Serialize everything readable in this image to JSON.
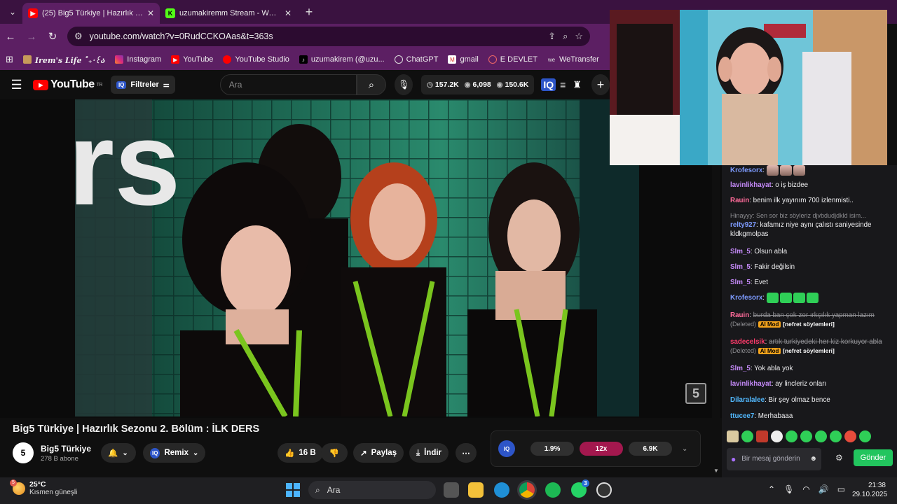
{
  "tabs": [
    {
      "title": "(25) Big5 Türkiye | Hazırlık Sezo",
      "favicon": "youtube-icon",
      "active": true
    },
    {
      "title": "uzumakiremm Stream - Watch Li",
      "favicon": "kick-icon",
      "active": false
    }
  ],
  "address": {
    "url": "youtube.com/watch?v=0RudCCKOAas&t=363s"
  },
  "bookmarks": [
    {
      "label": "Irem's Life ˚₊‧꒰ა",
      "icon": "bookmark-icon"
    },
    {
      "label": "Instagram",
      "icon": "instagram-icon"
    },
    {
      "label": "YouTube",
      "icon": "youtube-icon"
    },
    {
      "label": "YouTube Studio",
      "icon": "youtube-studio-icon"
    },
    {
      "label": "uzumakirem (@uzu...",
      "icon": "tiktok-icon"
    },
    {
      "label": "ChatGPT",
      "icon": "chatgpt-icon"
    },
    {
      "label": "gmail",
      "icon": "gmail-icon"
    },
    {
      "label": "E DEVLET",
      "icon": "edevlet-icon"
    },
    {
      "label": "WeTransfer",
      "icon": "wetransfer-icon"
    }
  ],
  "youtube": {
    "logo": "YouTube",
    "logo_sup": "TR",
    "filters_label": "Filtreler",
    "search_placeholder": "Ara",
    "stats": {
      "likes": "157.2K",
      "views": "6,098",
      "watch": "150.6K"
    }
  },
  "video": {
    "title": "Big5 Türkiye | Hazırlık Sezonu 2. Bölüm : İLK DERS",
    "channel_name": "Big5 Türkiye",
    "channel_subs": "278 B abone",
    "watermark": "5",
    "remix_label": "Remix",
    "like_count": "16 B",
    "share_label": "Paylaş",
    "download_label": "İndir"
  },
  "iq_panel": {
    "logo": "IQ",
    "metric1": "1.9%",
    "metric2": "12x",
    "metric3": "6.9K"
  },
  "chat": {
    "messages": [
      {
        "user": "Krofesorx",
        "text": "",
        "kind": "emotes-face"
      },
      {
        "user": "lavinlikhayat",
        "text": "o iş bizdee"
      },
      {
        "user": "Rauin",
        "text": "benim ilk yayınım 700 izlenmisti.."
      },
      {
        "reply": "Hinayyy: Sen sor biz söyleriz djvbdudjdkld isim...",
        "user": "relty927",
        "text": "kafamız niye aynı çalıstı saniyesinde kldkgmolpas"
      },
      {
        "user": "Slm_5",
        "text": "Olsun abla"
      },
      {
        "user": "Slm_5",
        "text": "Fakir değilsin"
      },
      {
        "user": "Slm_5",
        "text": "Evet"
      },
      {
        "user": "Krofesorx",
        "text": "",
        "kind": "emotes-green"
      },
      {
        "user": "Rauin",
        "text": "burda ban çok zor ırkçılık yapman lazım",
        "deleted_note": "(Deleted)",
        "mod": "AI Mod",
        "reason": "[nefret söylemleri]"
      },
      {
        "user": "sadecelsik",
        "text": "artık turkiyedeki her kiz korkuyor abla",
        "deleted_note": "(Deleted)",
        "mod": "AI Mod",
        "reason": "[nefret söylemleri]"
      },
      {
        "user": "Slm_5",
        "text": "Yok abla yok"
      },
      {
        "user": "lavinlikhayat",
        "text": "ay lincleriz onları"
      },
      {
        "user": "Dilaralalee",
        "text": "Bir şey olmaz bence"
      },
      {
        "user": "ttucee7",
        "text": "Merhabaaa"
      }
    ],
    "input_placeholder": "Bir mesaj gönderin",
    "send_label": "Gönder"
  },
  "taskbar": {
    "temperature": "25°C",
    "weather": "Kısmen güneşli",
    "weather_badge": "5",
    "search_label": "Ara",
    "whatsapp_badge": "3",
    "time": "21:38",
    "date": "29.10.2025"
  },
  "colors": {
    "chrome": "#5c1f63",
    "tabbar": "#3a1240",
    "youtube_red": "#ff0000",
    "kick_green": "#53fc18",
    "send_green": "#22c55e"
  }
}
